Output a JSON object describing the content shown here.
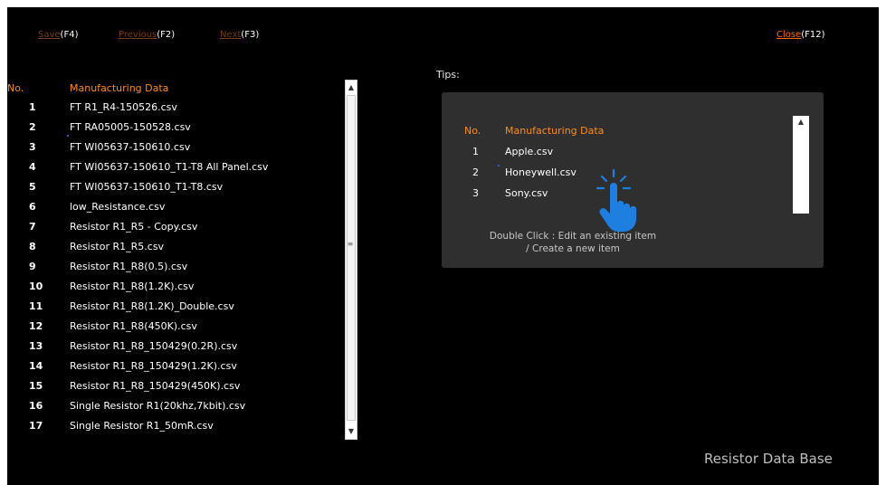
{
  "toolbar": {
    "save_label": "Save",
    "save_key": "(F4)",
    "previous_label": "Previous",
    "previous_key": "(F2)",
    "next_label": "Next",
    "next_key": "(F3)",
    "close_label": "Close",
    "close_key": "(F12)"
  },
  "list": {
    "col_no": "No.",
    "col_name": "Manufacturing Data",
    "rows": [
      {
        "no": "1",
        "name": "FT R1_R4-150526.csv"
      },
      {
        "no": "2",
        "name": "FT RA05005-150528.csv"
      },
      {
        "no": "3",
        "name": "FT WI05637-150610.csv"
      },
      {
        "no": "4",
        "name": "FT WI05637-150610_T1-T8 All Panel.csv"
      },
      {
        "no": "5",
        "name": "FT WI05637-150610_T1-T8.csv"
      },
      {
        "no": "6",
        "name": "low_Resistance.csv"
      },
      {
        "no": "7",
        "name": "Resistor R1_R5 - Copy.csv"
      },
      {
        "no": "8",
        "name": "Resistor R1_R5.csv"
      },
      {
        "no": "9",
        "name": "Resistor R1_R8(0.5).csv"
      },
      {
        "no": "10",
        "name": "Resistor R1_R8(1.2K).csv"
      },
      {
        "no": "11",
        "name": "Resistor R1_R8(1.2K)_Double.csv"
      },
      {
        "no": "12",
        "name": "Resistor R1_R8(450K).csv"
      },
      {
        "no": "13",
        "name": "Resistor R1_R8_150429(0.2R).csv"
      },
      {
        "no": "14",
        "name": "Resistor R1_R8_150429(1.2K).csv"
      },
      {
        "no": "15",
        "name": "Resistor R1_R8_150429(450K).csv"
      },
      {
        "no": "16",
        "name": "Single Resistor R1(20khz,7kbit).csv"
      },
      {
        "no": "17",
        "name": "Single Resistor R1_50mR.csv"
      }
    ]
  },
  "tips": {
    "label": "Tips:",
    "col_no": "No.",
    "col_name": "Manufacturing Data",
    "rows": [
      {
        "no": "1",
        "name": "Apple.csv"
      },
      {
        "no": "2",
        "name": "Honeywell.csv"
      },
      {
        "no": "3",
        "name": "Sony.csv"
      }
    ],
    "note_line1": "Double Click : Edit an existing item",
    "note_line2": "/ Create a new item"
  },
  "brand": "Resistor Data Base",
  "colors": {
    "accent": "#ff6a00",
    "header": "#ff8c1a",
    "hand": "#1e7fe0"
  }
}
